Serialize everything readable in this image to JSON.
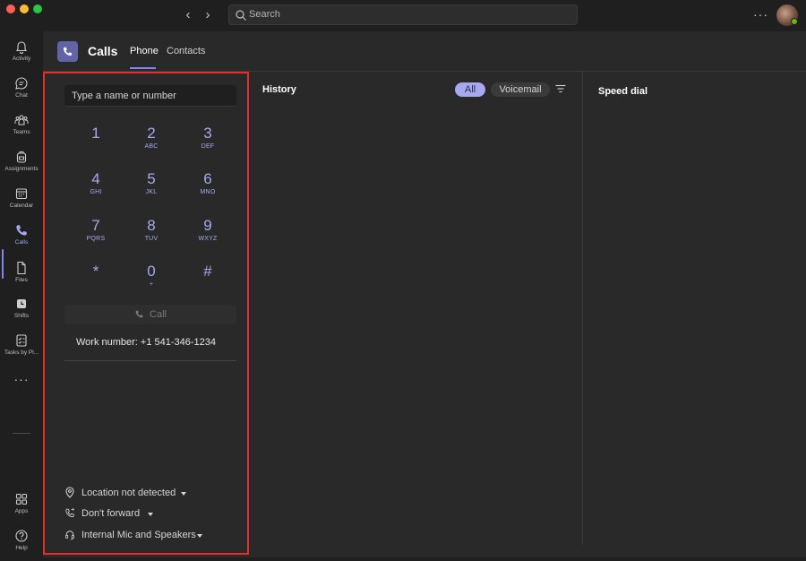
{
  "titlebar": {
    "search_placeholder": "Search",
    "back_icon": "chevron-left-icon",
    "forward_icon": "chevron-right-icon",
    "more_label": "···"
  },
  "rail": {
    "items": [
      {
        "label": "Activity",
        "icon": "bell-icon"
      },
      {
        "label": "Chat",
        "icon": "chat-icon"
      },
      {
        "label": "Teams",
        "icon": "teams-icon"
      },
      {
        "label": "Assignments",
        "icon": "backpack-icon"
      },
      {
        "label": "Calendar",
        "icon": "calendar-icon"
      },
      {
        "label": "Calls",
        "icon": "phone-icon",
        "active": true
      },
      {
        "label": "Files",
        "icon": "file-icon"
      },
      {
        "label": "Shifts",
        "icon": "clock-icon"
      },
      {
        "label": "Tasks by Pl...",
        "icon": "tasks-icon"
      }
    ],
    "more_label": "···",
    "apps_label": "Apps",
    "help_label": "Help"
  },
  "header": {
    "title": "Calls",
    "tabs": [
      {
        "label": "Phone",
        "selected": true
      },
      {
        "label": "Contacts",
        "selected": false
      }
    ]
  },
  "dialer": {
    "input_placeholder": "Type a name or number",
    "keys": [
      {
        "digit": "1",
        "letters": ""
      },
      {
        "digit": "2",
        "letters": "ABC"
      },
      {
        "digit": "3",
        "letters": "DEF"
      },
      {
        "digit": "4",
        "letters": "GHI"
      },
      {
        "digit": "5",
        "letters": "JKL"
      },
      {
        "digit": "6",
        "letters": "MNO"
      },
      {
        "digit": "7",
        "letters": "PQRS"
      },
      {
        "digit": "8",
        "letters": "TUV"
      },
      {
        "digit": "9",
        "letters": "WXYZ"
      },
      {
        "digit": "*",
        "letters": ""
      },
      {
        "digit": "0",
        "letters": "+"
      },
      {
        "digit": "#",
        "letters": ""
      }
    ],
    "call_label": "Call",
    "work_number": "Work number: +1 541-346-1234",
    "settings": {
      "location": "Location not detected",
      "forward": "Don't forward",
      "device": "Internal Mic and Speakers"
    }
  },
  "history": {
    "title": "History",
    "filters": {
      "all": "All",
      "voicemail": "Voicemail"
    }
  },
  "speed_dial": {
    "title": "Speed dial"
  },
  "colors": {
    "accent": "#7f85f5",
    "highlight_border": "#e0302c",
    "presence": "#6bb700"
  }
}
